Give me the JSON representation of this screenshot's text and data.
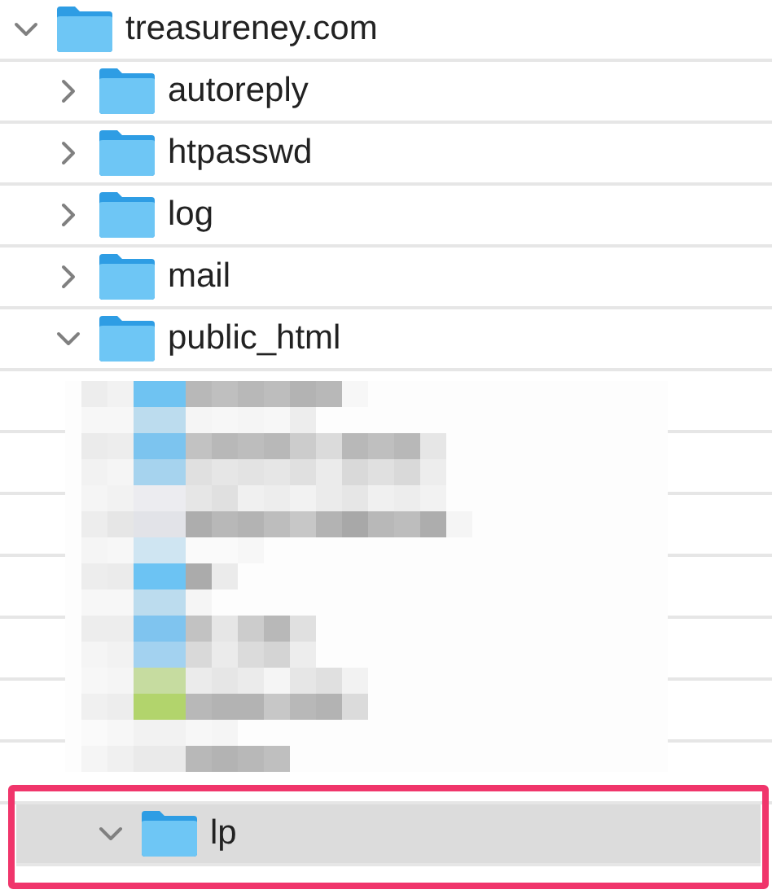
{
  "tree": [
    {
      "kind": "folder",
      "name": "treasureney.com",
      "expanded": true,
      "selected": false,
      "annotated": false,
      "children": [
        {
          "kind": "folder",
          "name": "autoreply",
          "expanded": false,
          "selected": false,
          "annotated": false
        },
        {
          "kind": "folder",
          "name": "htpasswd",
          "expanded": false,
          "selected": false,
          "annotated": false
        },
        {
          "kind": "folder",
          "name": "log",
          "expanded": false,
          "selected": false,
          "annotated": false
        },
        {
          "kind": "folder",
          "name": "mail",
          "expanded": false,
          "selected": false,
          "annotated": false
        },
        {
          "kind": "folder",
          "name": "public_html",
          "expanded": true,
          "selected": false,
          "annotated": false,
          "children": [
            {
              "kind": "redacted"
            },
            {
              "kind": "folder",
              "name": "lp",
              "expanded": true,
              "selected": true,
              "annotated": true
            }
          ]
        }
      ]
    }
  ]
}
